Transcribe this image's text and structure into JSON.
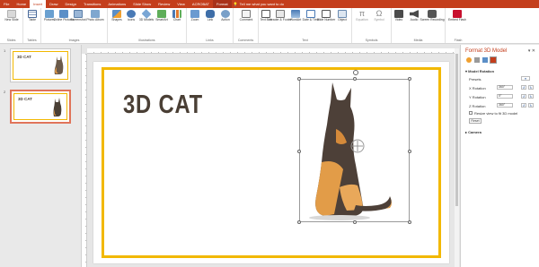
{
  "tabs": [
    "File",
    "Home",
    "Insert",
    "Draw",
    "Design",
    "Transitions",
    "Animations",
    "Slide Show",
    "Review",
    "View",
    "ACROBAT",
    "Format"
  ],
  "active_tab": "Insert",
  "tell_me": "Tell me what you want to do",
  "ribbon": {
    "groups": [
      "Slides",
      "Tables",
      "Images",
      "Illustrations",
      "Links",
      "Comments",
      "Text",
      "Symbols",
      "Media",
      "Flash"
    ],
    "buttons": [
      "New Slide",
      "Table",
      "Pictures",
      "Online Pictures",
      "Screenshot",
      "Photo Album",
      "Shapes",
      "Icons",
      "3D Models",
      "SmartArt",
      "Chart",
      "Zoom",
      "Link",
      "Action",
      "Comment",
      "Text Box",
      "Header & Footer",
      "WordArt",
      "Date & Time",
      "Slide Number",
      "Object",
      "Equation",
      "Symbol",
      "Video",
      "Audio",
      "Screen Recording",
      "Embed Flash"
    ]
  },
  "slides": [
    {
      "num": "1",
      "title": "3D CAT"
    },
    {
      "num": "2",
      "title": "3D CAT"
    }
  ],
  "main_slide": {
    "title": "3D CAT"
  },
  "pane": {
    "title": "Format 3D Model",
    "section_rotation": "Model Rotation",
    "presets_label": "Presets",
    "x_label": "X Rotation",
    "x_value": "360°",
    "y_label": "Y Rotation",
    "y_value": "0°",
    "z_label": "Z Rotation",
    "z_value": "360°",
    "resize_label": "Resize view to fit 3D model",
    "reset_label": "Reset",
    "section_camera": "Camera"
  },
  "colors": {
    "accent": "#c43e1c",
    "frame": "#f2b800",
    "title_text": "#4a3f35"
  }
}
